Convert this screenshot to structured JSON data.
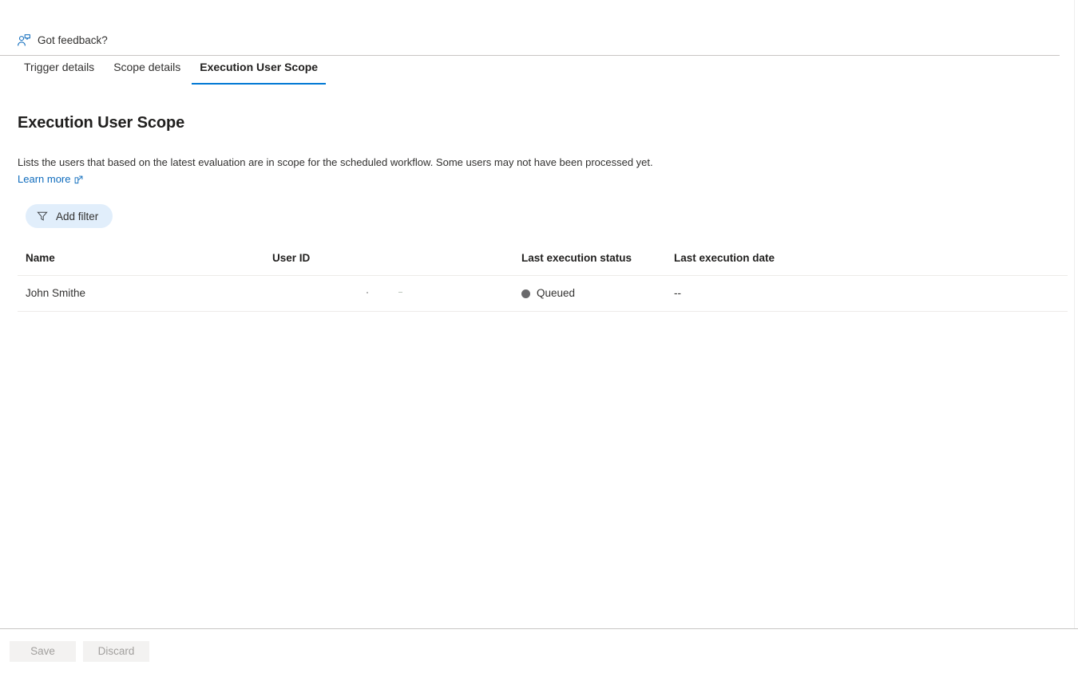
{
  "feedback": {
    "label": "Got feedback?",
    "icon": "person-feedback-icon"
  },
  "tabs": [
    {
      "label": "Trigger details",
      "active": false
    },
    {
      "label": "Scope details",
      "active": false
    },
    {
      "label": "Execution User Scope",
      "active": true
    }
  ],
  "page": {
    "title": "Execution User Scope",
    "description": "Lists the users that based on the latest evaluation are in scope for the scheduled workflow. Some users may not have been processed yet.",
    "learn_more": "Learn more"
  },
  "toolbar": {
    "add_filter_label": "Add filter",
    "filter_icon": "funnel-icon"
  },
  "table": {
    "columns": [
      "Name",
      "User ID",
      "Last execution status",
      "Last execution date"
    ],
    "rows": [
      {
        "name": "John Smithe",
        "user_id": "",
        "status": "Queued",
        "status_color": "#69696b",
        "last_execution_date": "--"
      }
    ]
  },
  "bottom_bar": {
    "save_label": "Save",
    "discard_label": "Discard"
  },
  "colors": {
    "accent": "#0078d4",
    "link": "#0f6cbd",
    "filter_pill_bg": "#e1eefb",
    "disabled_btn_bg": "#f3f2f1",
    "disabled_btn_text": "#a19f9d"
  }
}
